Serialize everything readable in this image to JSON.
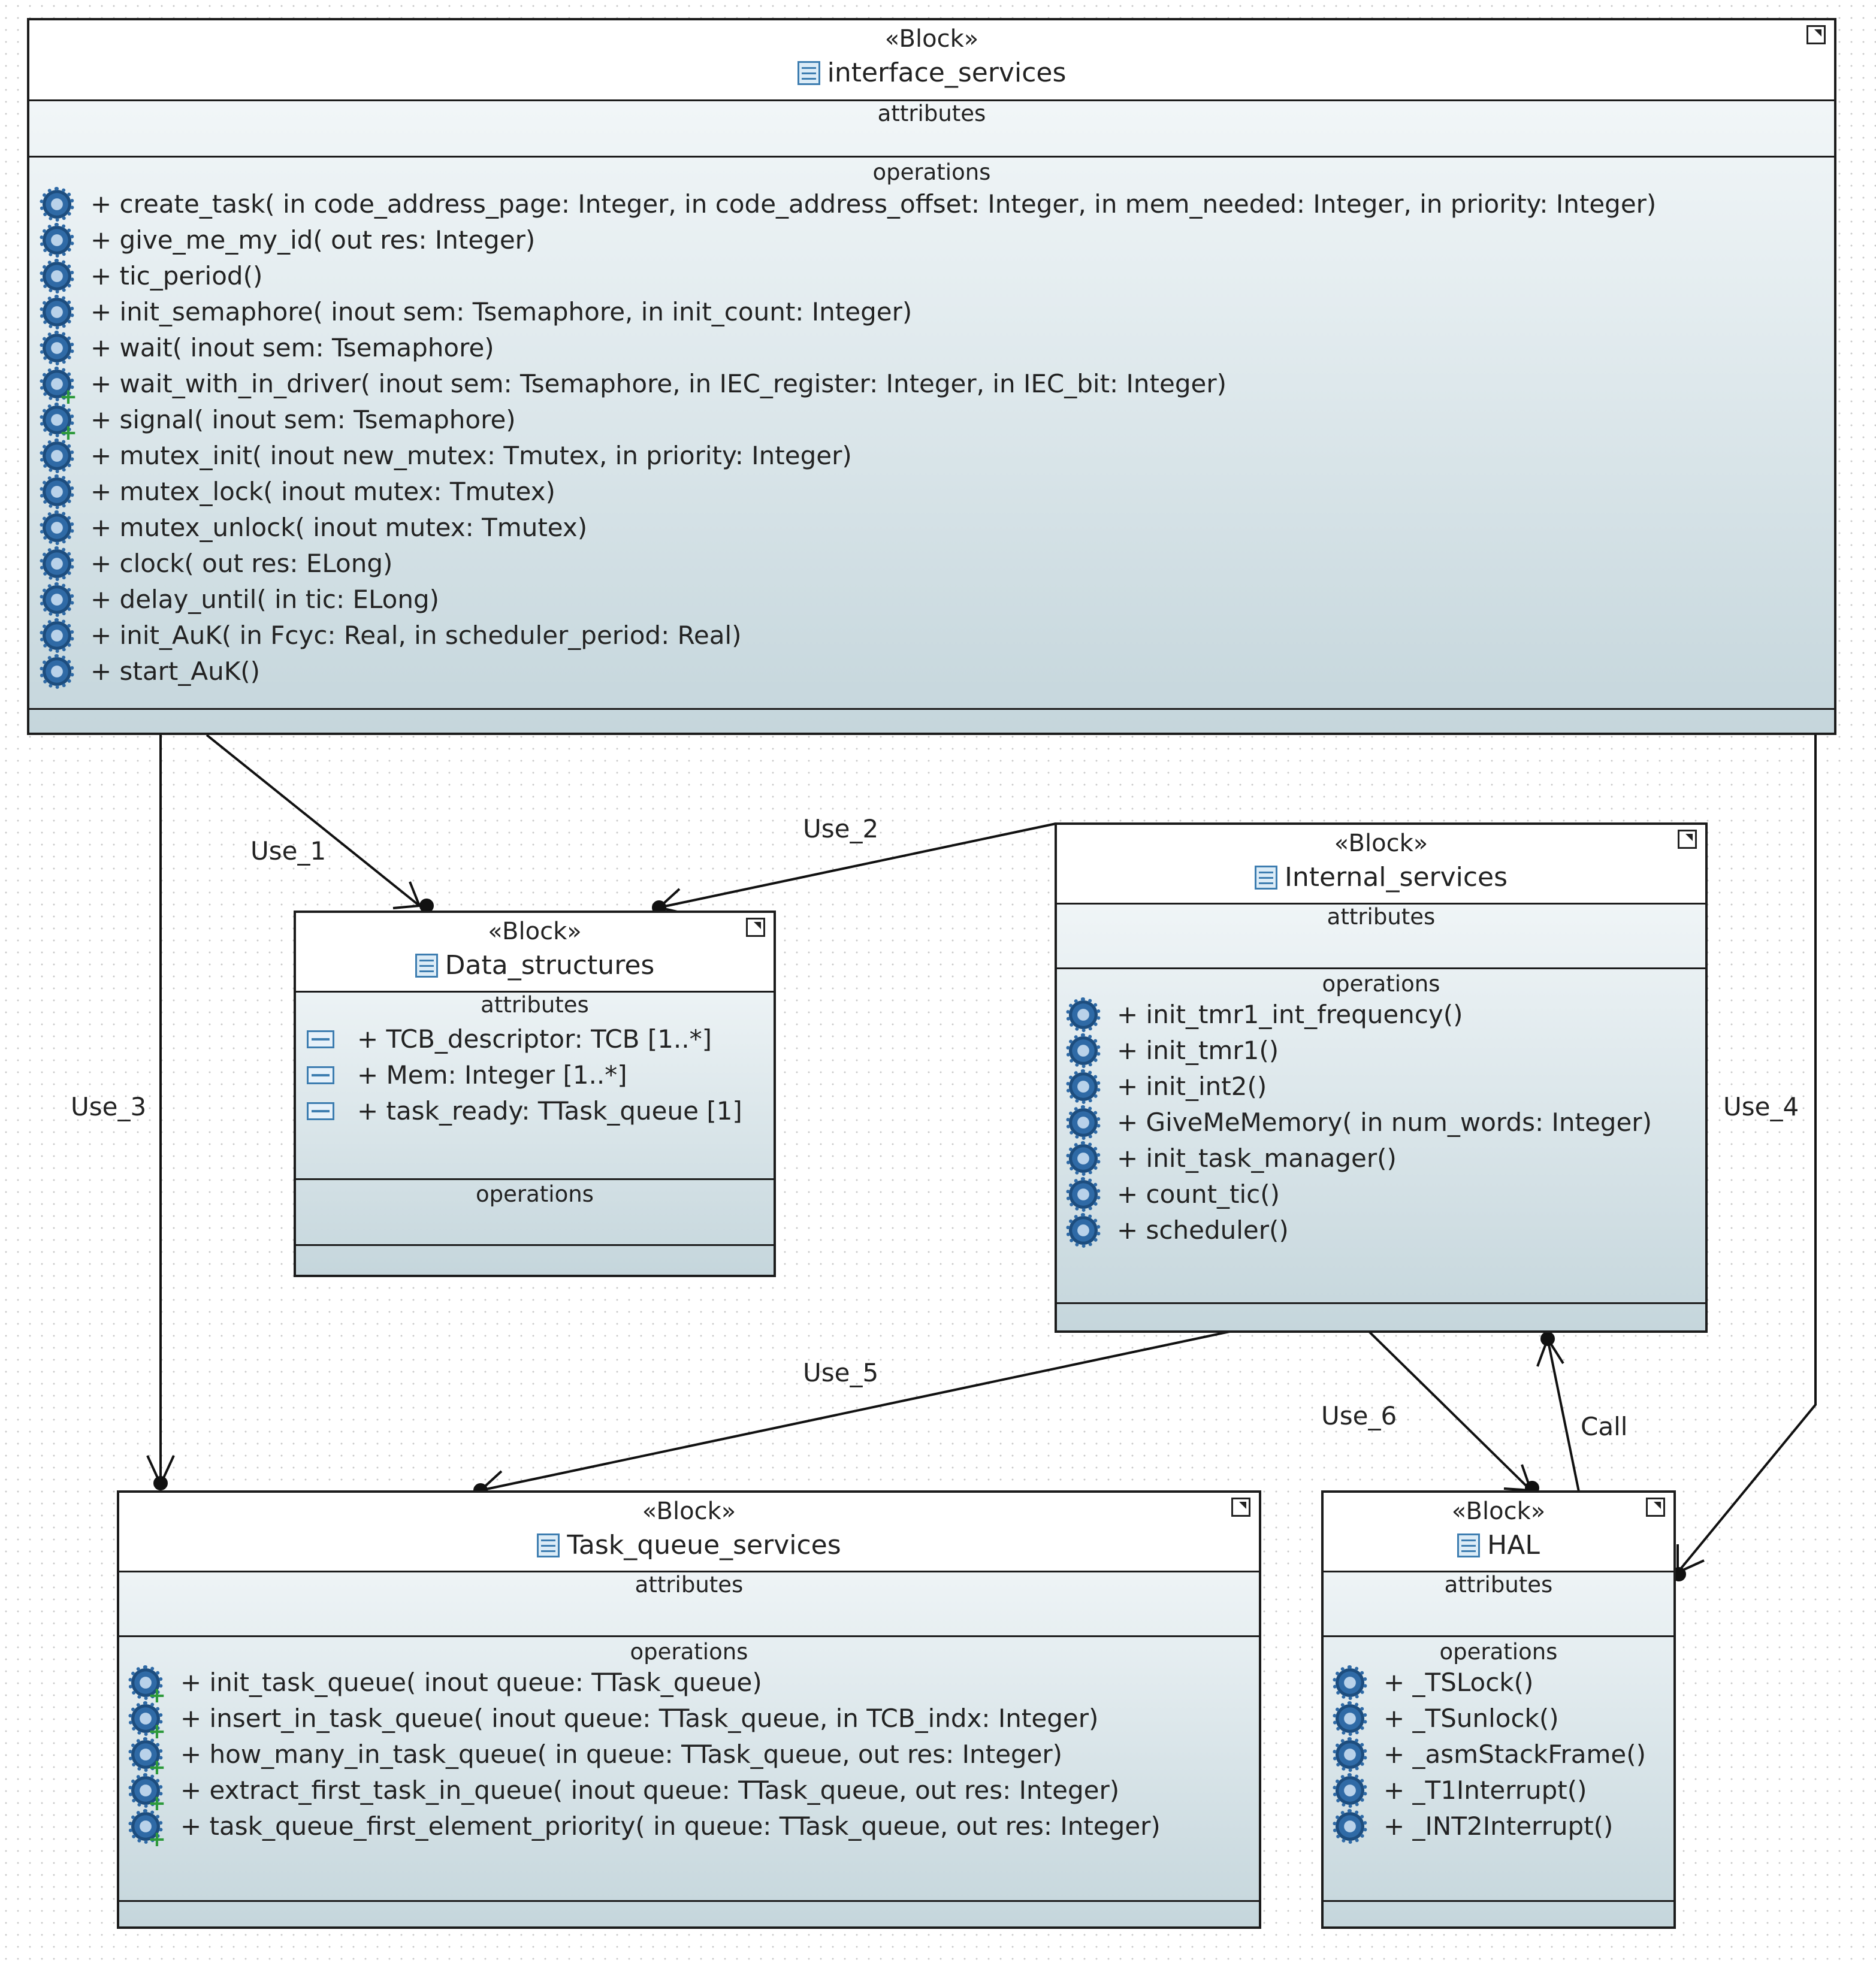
{
  "diagram": {
    "section_labels": {
      "attributes": "attributes",
      "operations": "operations"
    },
    "blocks": {
      "interface_services": {
        "stereotype": "«Block»",
        "name": "interface_services",
        "operations": [
          "+ create_task(  in code_address_page: Integer,   in code_address_offset: Integer,   in mem_needed: Integer,   in priority: Integer)",
          "+ give_me_my_id(  out res: Integer)",
          "+ tic_period()",
          "+ init_semaphore(  inout sem: Tsemaphore,   in init_count: Integer)",
          "+ wait(  inout sem: Tsemaphore)",
          "+ wait_with_in_driver(  inout sem: Tsemaphore,   in IEC_register: Integer,   in IEC_bit: Integer)",
          "+ signal(  inout sem: Tsemaphore)",
          "+ mutex_init(  inout new_mutex: Tmutex,   in priority: Integer)",
          "+ mutex_lock(  inout mutex: Tmutex)",
          "+ mutex_unlock(  inout mutex: Tmutex)",
          "+ clock(  out res: ELong)",
          "+ delay_until(  in tic: ELong)",
          "+ init_AuK(  in Fcyc: Real,   in scheduler_period: Real)",
          "+ start_AuK()"
        ],
        "operation_icon_plus": [
          false,
          false,
          false,
          false,
          false,
          true,
          true,
          false,
          false,
          false,
          false,
          false,
          false,
          false
        ]
      },
      "data_structures": {
        "stereotype": "«Block»",
        "name": "Data_structures",
        "attributes": [
          "+ TCB_descriptor: TCB [1..*]",
          "+ Mem: Integer [1..*]",
          "+ task_ready: TTask_queue [1]"
        ]
      },
      "internal_services": {
        "stereotype": "«Block»",
        "name": "Internal_services",
        "operations": [
          "+ init_tmr1_int_frequency()",
          "+ init_tmr1()",
          "+ init_int2()",
          "+ GiveMeMemory(  in num_words: Integer)",
          "+ init_task_manager()",
          "+ count_tic()",
          "+ scheduler()"
        ]
      },
      "task_queue_services": {
        "stereotype": "«Block»",
        "name": "Task_queue_services",
        "operations": [
          "+ init_task_queue(  inout queue: TTask_queue)",
          "+ insert_in_task_queue(  inout queue: TTask_queue,   in TCB_indx: Integer)",
          "+ how_many_in_task_queue(  in queue: TTask_queue,   out res: Integer)",
          "+ extract_first_task_in_queue(  inout queue: TTask_queue,   out res: Integer)",
          "+ task_queue_first_element_priority(  in queue: TTask_queue,   out res: Integer)"
        ]
      },
      "hal": {
        "stereotype": "«Block»",
        "name": "HAL",
        "operations": [
          "+ _TSLock()",
          "+ _TSunlock()",
          "+ _asmStackFrame()",
          "+ _T1Interrupt()",
          "+ _INT2Interrupt()"
        ]
      }
    },
    "edges": [
      {
        "id": "use1",
        "label": "Use_1",
        "from": "interface_services",
        "to": "Data_structures"
      },
      {
        "id": "use2",
        "label": "Use_2",
        "from": "Internal_services",
        "to": "Data_structures"
      },
      {
        "id": "use3",
        "label": "Use_3",
        "from": "interface_services",
        "to": "Task_queue_services"
      },
      {
        "id": "use4",
        "label": "Use_4",
        "from": "interface_services",
        "to": "HAL"
      },
      {
        "id": "use5",
        "label": "Use_5",
        "from": "Internal_services",
        "to": "Task_queue_services"
      },
      {
        "id": "use6",
        "label": "Use_6",
        "from": "Internal_services",
        "to": "HAL"
      },
      {
        "id": "call",
        "label": "Call",
        "from": "HAL",
        "to": "Internal_services"
      }
    ]
  }
}
